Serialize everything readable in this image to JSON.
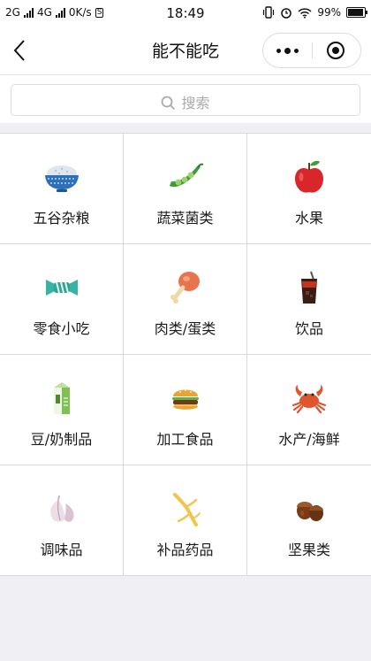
{
  "status_bar": {
    "carrier1": "2G",
    "carrier2": "4G",
    "speed": "0K/s",
    "s_badge": "S",
    "time": "18:49",
    "battery": "99%"
  },
  "nav": {
    "title": "能不能吃",
    "back_icon": "chevron-left-icon",
    "more_icon": "more-dots-icon",
    "close_icon": "target-close-icon"
  },
  "search": {
    "placeholder": "搜索",
    "icon": "search-icon"
  },
  "categories": [
    {
      "label": "五谷杂粮",
      "icon": "rice-bowl-icon"
    },
    {
      "label": "蔬菜菌类",
      "icon": "pea-pod-icon"
    },
    {
      "label": "水果",
      "icon": "apple-icon"
    },
    {
      "label": "零食小吃",
      "icon": "candy-icon"
    },
    {
      "label": "肉类/蛋类",
      "icon": "drumstick-icon"
    },
    {
      "label": "饮品",
      "icon": "drink-cup-icon"
    },
    {
      "label": "豆/奶制品",
      "icon": "milk-carton-icon"
    },
    {
      "label": "加工食品",
      "icon": "burger-icon"
    },
    {
      "label": "水产/海鲜",
      "icon": "crab-icon"
    },
    {
      "label": "调味品",
      "icon": "garlic-icon"
    },
    {
      "label": "补品药品",
      "icon": "ginseng-icon"
    },
    {
      "label": "坚果类",
      "icon": "nuts-icon"
    }
  ]
}
